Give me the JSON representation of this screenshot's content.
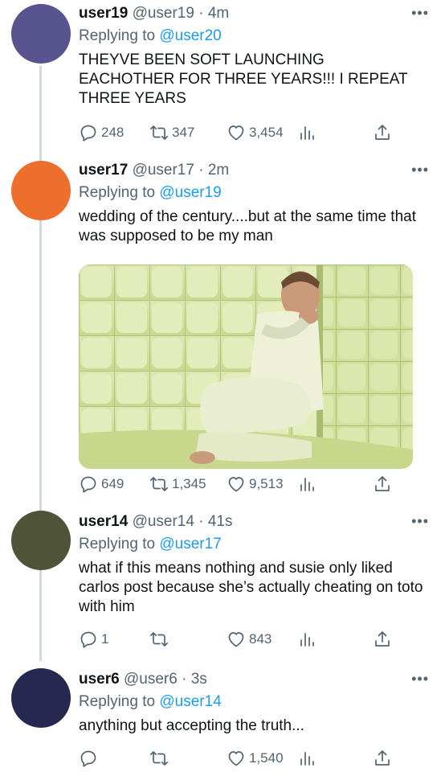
{
  "tweets": [
    {
      "name": "user19",
      "handle": "@user19",
      "sep": "·",
      "time": "4m",
      "reply_prefix": "Replying to",
      "reply_to": "@user20",
      "text": "THEYVE BEEN SOFT LAUNCHING EACHOTHER FOR THREE YEARS!!! I REPEAT THREE YEARS",
      "replies": "248",
      "retweets": "347",
      "likes": "3,454",
      "avatar_color": "#57548f"
    },
    {
      "name": "user17",
      "handle": "@user17",
      "sep": "·",
      "time": "2m",
      "reply_prefix": "Replying to",
      "reply_to": "@user19",
      "text": "wedding of the century....but at the same time that was supposed to be my man",
      "replies": "649",
      "retweets": "1,345",
      "likes": "9,513",
      "avatar_color": "#ee6f2d"
    },
    {
      "name": "user14",
      "handle": "@user14",
      "sep": "·",
      "time": "41s",
      "reply_prefix": "Replying to",
      "reply_to": "@user17",
      "text": "what if this means nothing and susie only liked carlos post because she’s actually cheating on toto with him",
      "replies": "1",
      "retweets": "",
      "likes": "843",
      "avatar_color": "#4f5338"
    },
    {
      "name": "user6",
      "handle": "@user6",
      "sep": "·",
      "time": "3s",
      "reply_prefix": "Replying to",
      "reply_to": "@user14",
      "text": "anything but accepting the truth...",
      "replies": "",
      "retweets": "",
      "likes": "1,540",
      "avatar_color": "#272850"
    }
  ],
  "icons": {
    "reply": "reply-icon",
    "retweet": "retweet-icon",
    "like": "heart-icon",
    "views": "analytics-icon",
    "share": "share-icon",
    "more": "more-icon"
  },
  "more_glyph": "•••"
}
